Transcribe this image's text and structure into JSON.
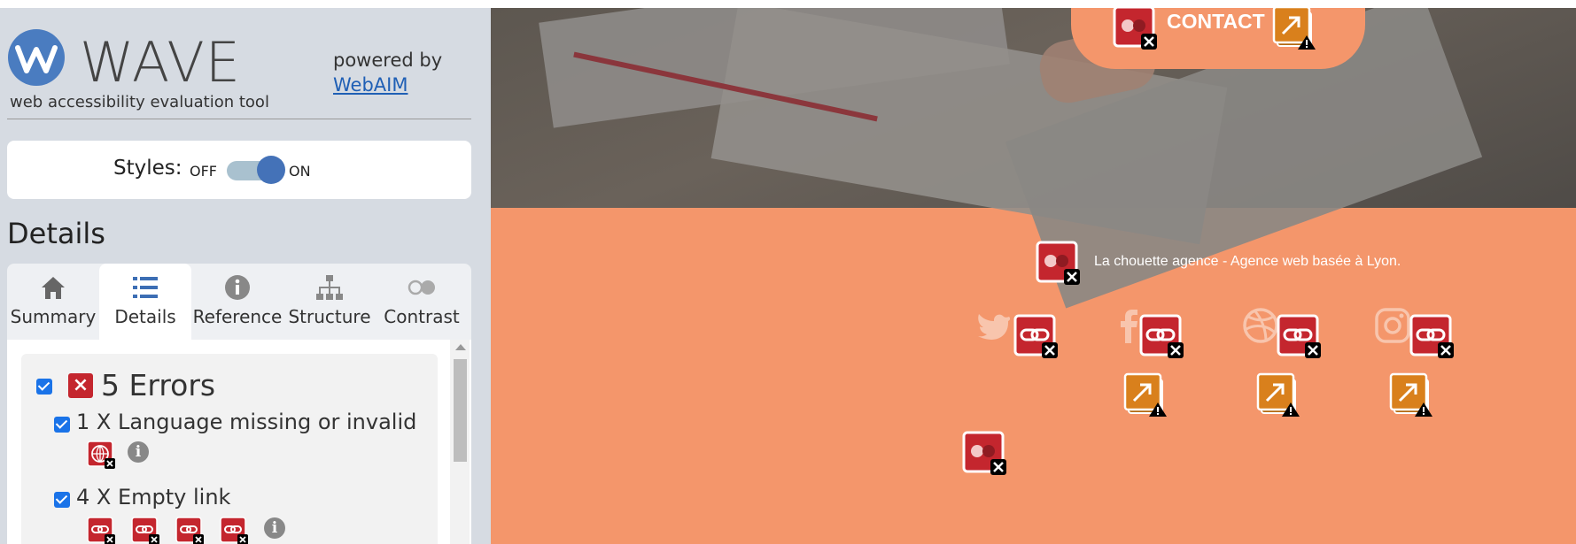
{
  "wave": {
    "logo_word": "WAVE",
    "subtitle": "web accessibility evaluation tool",
    "powered_by": "powered by",
    "webaim_link": "WebAIM",
    "styles_label": "Styles:",
    "styles_off": "OFF",
    "styles_on": "ON",
    "styles_state": "on",
    "details_heading": "Details",
    "tabs": [
      {
        "label": "Summary",
        "icon": "home-icon"
      },
      {
        "label": "Details",
        "icon": "list-icon",
        "active": true
      },
      {
        "label": "Reference",
        "icon": "info-icon"
      },
      {
        "label": "Structure",
        "icon": "hierarchy-icon"
      },
      {
        "label": "Contrast",
        "icon": "contrast-icon"
      }
    ],
    "errors": {
      "title": "5 Errors",
      "items": [
        {
          "label": "1 X Language missing or invalid",
          "count": 1,
          "icon": "language-error-icon"
        },
        {
          "label": "4 X Empty link",
          "count": 4,
          "icon": "empty-link-error-icon"
        }
      ]
    }
  },
  "page": {
    "contact_button": "CONTACT",
    "tagline": "La chouette agence - Agence web basée à Lyon.",
    "social_icons": [
      "twitter-icon",
      "facebook-icon",
      "dribbble-icon",
      "instagram-icon"
    ],
    "colors": {
      "background": "#f4966b",
      "error": "#c4262e",
      "alert": "#d9801c"
    }
  }
}
